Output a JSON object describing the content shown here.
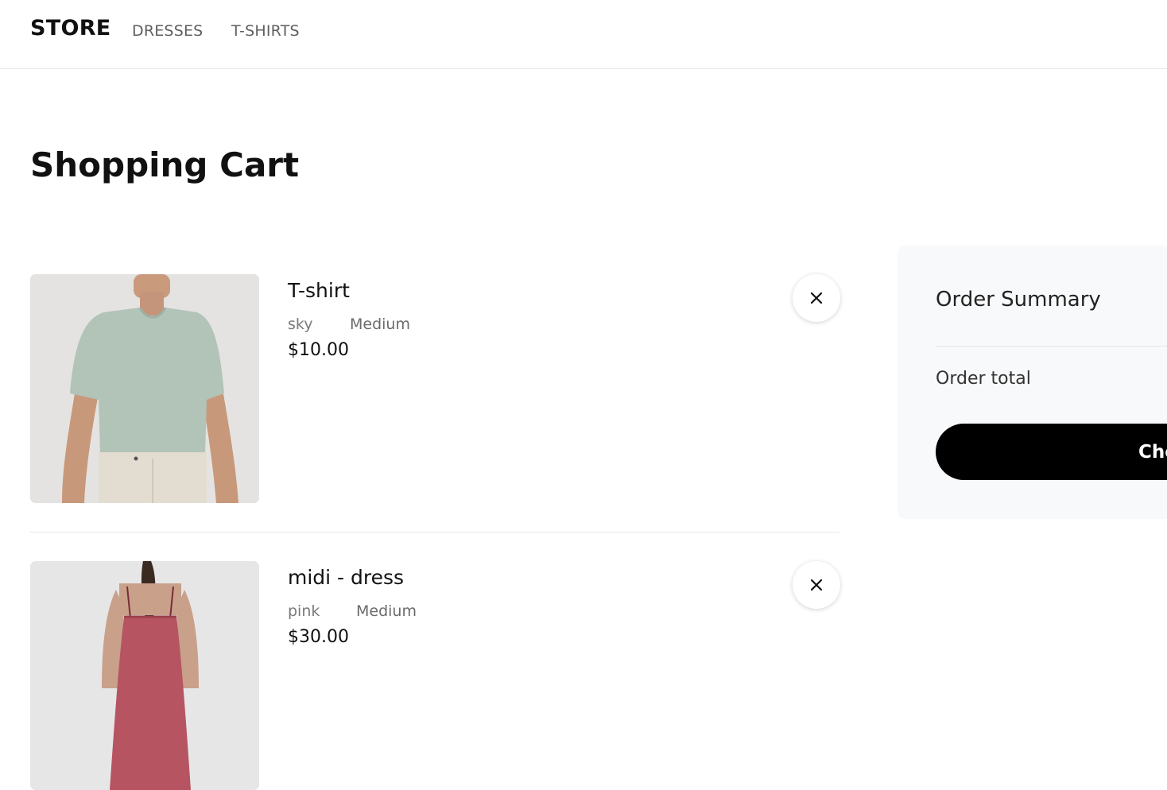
{
  "header": {
    "brand": "STORE",
    "nav": [
      "DRESSES",
      "T-SHIRTS"
    ]
  },
  "page": {
    "title": "Shopping Cart"
  },
  "cart": {
    "items": [
      {
        "name": "T-shirt",
        "color": "sky",
        "size": "Medium",
        "price": "$10.00",
        "image_icon": "tshirt-photo"
      },
      {
        "name": "midi - dress",
        "color": "pink",
        "size": "Medium",
        "price": "$30.00",
        "image_icon": "dress-photo"
      }
    ],
    "remove_icon": "close-icon"
  },
  "summary": {
    "title": "Order Summary",
    "total_label": "Order total",
    "checkout_label": "Checkout"
  },
  "colors": {
    "accent": "#000000",
    "summary_bg": "#f8f9fa",
    "muted_text": "#6b6b6b"
  }
}
